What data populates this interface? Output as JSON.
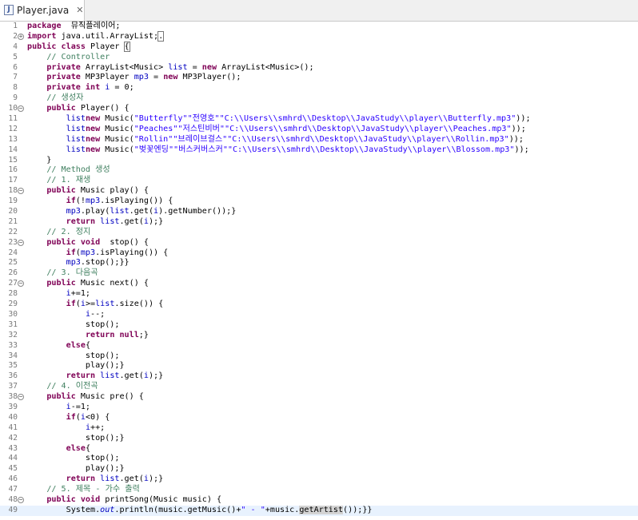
{
  "tab": {
    "title": "Player.java",
    "icon": "java-file-icon",
    "close": "✕"
  },
  "colors": {
    "keyword": "#7f0055",
    "string": "#2a00ff",
    "comment": "#3f7f5f",
    "field": "#0000c0"
  },
  "current_line": 49,
  "lines": [
    {
      "n": "1",
      "t": [
        [
          "kw",
          "package"
        ],
        [
          "",
          "  뮤직플레이어;"
        ]
      ]
    },
    {
      "n": "2",
      "fold": "+",
      "t": [
        [
          "kw",
          "import"
        ],
        [
          "",
          " java.util.ArrayList;"
        ],
        [
          "box",
          "."
        ]
      ]
    },
    {
      "n": "4",
      "t": [
        [
          "kw",
          "public class"
        ],
        [
          "",
          " Player "
        ],
        [
          "box",
          "{"
        ]
      ]
    },
    {
      "n": "5",
      "t": [
        [
          "",
          "    "
        ],
        [
          "cm",
          "// Controller"
        ]
      ]
    },
    {
      "n": "6",
      "t": [
        [
          "",
          "    "
        ],
        [
          "kw",
          "private"
        ],
        [
          "",
          " ArrayList<Music> "
        ],
        [
          "fld",
          "list"
        ],
        [
          "",
          " = "
        ],
        [
          "kw",
          "new"
        ],
        [
          "",
          " ArrayList<Music>();"
        ]
      ]
    },
    {
      "n": "7",
      "t": [
        [
          "",
          "    "
        ],
        [
          "kw",
          "private"
        ],
        [
          "",
          " MP3Player "
        ],
        [
          "fld",
          "mp3"
        ],
        [
          "",
          " = "
        ],
        [
          "kw",
          "new"
        ],
        [
          "",
          " MP3Player();"
        ]
      ]
    },
    {
      "n": "8",
      "t": [
        [
          "",
          "    "
        ],
        [
          "kw",
          "private int"
        ],
        [
          "",
          " "
        ],
        [
          "fld",
          "i"
        ],
        [
          "",
          " = 0;"
        ]
      ]
    },
    {
      "n": "9",
      "t": [
        [
          "",
          "    "
        ],
        [
          "cm",
          "// 생성자"
        ]
      ]
    },
    {
      "n": "10",
      "fold": "−",
      "t": [
        [
          "",
          "    "
        ],
        [
          "kw",
          "public"
        ],
        [
          "",
          " Player() {"
        ]
      ]
    },
    {
      "n": "11",
      "t": [
        [
          "",
          "        "
        ],
        [
          "fld",
          "list"
        ],
        [
          ".add("
        ],
        [
          "kw",
          "new"
        ],
        [
          "",
          " Music("
        ],
        [
          "str",
          "\"Butterfly\""
        ],
        [
          ", "
        ],
        [
          "str",
          "\"전영호\""
        ],
        [
          ", "
        ],
        [
          "str",
          "\"C:\\\\Users\\\\smhrd\\\\Desktop\\\\JavaStudy\\\\player\\\\Butterfly.mp3\""
        ],
        [
          "",
          "));"
        ]
      ]
    },
    {
      "n": "12",
      "t": [
        [
          "",
          "        "
        ],
        [
          "fld",
          "list"
        ],
        [
          ".add("
        ],
        [
          "kw",
          "new"
        ],
        [
          "",
          " Music("
        ],
        [
          "str",
          "\"Peaches\""
        ],
        [
          ", "
        ],
        [
          "str",
          "\"저스틴비버\""
        ],
        [
          ", "
        ],
        [
          "str",
          "\"C:\\\\Users\\\\smhrd\\\\Desktop\\\\JavaStudy\\\\player\\\\Peaches.mp3\""
        ],
        [
          "",
          "));"
        ]
      ]
    },
    {
      "n": "13",
      "t": [
        [
          "",
          "        "
        ],
        [
          "fld",
          "list"
        ],
        [
          ".add("
        ],
        [
          "kw",
          "new"
        ],
        [
          "",
          " Music("
        ],
        [
          "str",
          "\"Rollin\""
        ],
        [
          ", "
        ],
        [
          "str",
          "\"브레이브걸스\""
        ],
        [
          ", "
        ],
        [
          "str",
          "\"C:\\\\Users\\\\smhrd\\\\Desktop\\\\JavaStudy\\\\player\\\\Rollin.mp3\""
        ],
        [
          "",
          "));"
        ]
      ]
    },
    {
      "n": "14",
      "t": [
        [
          "",
          "        "
        ],
        [
          "fld",
          "list"
        ],
        [
          ".add("
        ],
        [
          "kw",
          "new"
        ],
        [
          "",
          " Music("
        ],
        [
          "str",
          "\"벚꽃엔딩\""
        ],
        [
          ", "
        ],
        [
          "str",
          "\"버스커버스커\""
        ],
        [
          ", "
        ],
        [
          "str",
          "\"C:\\\\Users\\\\smhrd\\\\Desktop\\\\JavaStudy\\\\player\\\\Blossom.mp3\""
        ],
        [
          "",
          "));"
        ]
      ]
    },
    {
      "n": "15",
      "t": [
        [
          "",
          "    }"
        ]
      ]
    },
    {
      "n": "16",
      "t": [
        [
          "",
          "    "
        ],
        [
          "cm",
          "// Method 생성"
        ]
      ]
    },
    {
      "n": "17",
      "t": [
        [
          "",
          "    "
        ],
        [
          "cm",
          "// 1. 재생"
        ]
      ]
    },
    {
      "n": "18",
      "fold": "−",
      "t": [
        [
          "",
          "    "
        ],
        [
          "kw",
          "public"
        ],
        [
          "",
          " Music play() {"
        ]
      ]
    },
    {
      "n": "19",
      "t": [
        [
          "",
          "        "
        ],
        [
          "kw",
          "if"
        ],
        [
          "",
          "(!"
        ],
        [
          "fld",
          "mp3"
        ],
        [
          "",
          ".isPlaying()) {"
        ]
      ]
    },
    {
      "n": "20",
      "t": [
        [
          "",
          "        "
        ],
        [
          "fld",
          "mp3"
        ],
        [
          "",
          ".play("
        ],
        [
          "fld",
          "list"
        ],
        [
          "",
          ".get("
        ],
        [
          "fld",
          "i"
        ],
        [
          "",
          ").getNumber());}"
        ]
      ]
    },
    {
      "n": "21",
      "t": [
        [
          "",
          "        "
        ],
        [
          "kw",
          "return"
        ],
        [
          "",
          " "
        ],
        [
          "fld",
          "list"
        ],
        [
          "",
          ".get("
        ],
        [
          "fld",
          "i"
        ],
        [
          "",
          ");}"
        ]
      ]
    },
    {
      "n": "22",
      "t": [
        [
          "",
          "    "
        ],
        [
          "cm",
          "// 2. 정지"
        ]
      ]
    },
    {
      "n": "23",
      "fold": "−",
      "t": [
        [
          "",
          "    "
        ],
        [
          "kw",
          "public void"
        ],
        [
          "",
          "  stop() {"
        ]
      ]
    },
    {
      "n": "24",
      "t": [
        [
          "",
          "        "
        ],
        [
          "kw",
          "if"
        ],
        [
          "",
          "("
        ],
        [
          "fld",
          "mp3"
        ],
        [
          "",
          ".isPlaying()) {"
        ]
      ]
    },
    {
      "n": "25",
      "t": [
        [
          "",
          "        "
        ],
        [
          "fld",
          "mp3"
        ],
        [
          "",
          ".stop();}}"
        ]
      ]
    },
    {
      "n": "26",
      "t": [
        [
          "",
          "    "
        ],
        [
          "cm",
          "// 3. 다음곡"
        ]
      ]
    },
    {
      "n": "27",
      "fold": "−",
      "t": [
        [
          "",
          "    "
        ],
        [
          "kw",
          "public"
        ],
        [
          "",
          " Music next() {"
        ]
      ]
    },
    {
      "n": "28",
      "t": [
        [
          "",
          "        "
        ],
        [
          "fld",
          "i"
        ],
        [
          "",
          "+=1;"
        ]
      ]
    },
    {
      "n": "29",
      "t": [
        [
          "",
          "        "
        ],
        [
          "kw",
          "if"
        ],
        [
          "",
          "("
        ],
        [
          "fld",
          "i"
        ],
        [
          "",
          ">="
        ],
        [
          "fld",
          "list"
        ],
        [
          "",
          ".size()) {"
        ]
      ]
    },
    {
      "n": "30",
      "t": [
        [
          "",
          "            "
        ],
        [
          "fld",
          "i"
        ],
        [
          "",
          "--;"
        ]
      ]
    },
    {
      "n": "31",
      "t": [
        [
          "",
          "            stop();"
        ]
      ]
    },
    {
      "n": "32",
      "t": [
        [
          "",
          "            "
        ],
        [
          "kw",
          "return null"
        ],
        [
          "",
          ";}"
        ]
      ]
    },
    {
      "n": "33",
      "t": [
        [
          "",
          "        "
        ],
        [
          "kw",
          "else"
        ],
        [
          "",
          "{"
        ]
      ]
    },
    {
      "n": "34",
      "t": [
        [
          "",
          "            stop();"
        ]
      ]
    },
    {
      "n": "35",
      "t": [
        [
          "",
          "            play();}"
        ]
      ]
    },
    {
      "n": "36",
      "t": [
        [
          "",
          "        "
        ],
        [
          "kw",
          "return"
        ],
        [
          "",
          " "
        ],
        [
          "fld",
          "list"
        ],
        [
          "",
          ".get("
        ],
        [
          "fld",
          "i"
        ],
        [
          "",
          ");}"
        ]
      ]
    },
    {
      "n": "37",
      "t": [
        [
          "",
          "    "
        ],
        [
          "cm",
          "// 4. 이전곡"
        ]
      ]
    },
    {
      "n": "38",
      "fold": "−",
      "t": [
        [
          "",
          "    "
        ],
        [
          "kw",
          "public"
        ],
        [
          "",
          " Music pre() {"
        ]
      ]
    },
    {
      "n": "39",
      "t": [
        [
          "",
          "        "
        ],
        [
          "fld",
          "i"
        ],
        [
          "",
          "-=1;"
        ]
      ]
    },
    {
      "n": "40",
      "t": [
        [
          "",
          "        "
        ],
        [
          "kw",
          "if"
        ],
        [
          "",
          "("
        ],
        [
          "fld",
          "i"
        ],
        [
          "",
          "<0) {"
        ]
      ]
    },
    {
      "n": "41",
      "t": [
        [
          "",
          "            "
        ],
        [
          "fld",
          "i"
        ],
        [
          "",
          "++;"
        ]
      ]
    },
    {
      "n": "42",
      "t": [
        [
          "",
          "            stop();}"
        ]
      ]
    },
    {
      "n": "43",
      "t": [
        [
          "",
          "        "
        ],
        [
          "kw",
          "else"
        ],
        [
          "",
          "{"
        ]
      ]
    },
    {
      "n": "44",
      "t": [
        [
          "",
          "            stop();"
        ]
      ]
    },
    {
      "n": "45",
      "t": [
        [
          "",
          "            play();}"
        ]
      ]
    },
    {
      "n": "46",
      "t": [
        [
          "",
          "        "
        ],
        [
          "kw",
          "return"
        ],
        [
          "",
          " "
        ],
        [
          "fld",
          "list"
        ],
        [
          "",
          ".get("
        ],
        [
          "fld",
          "i"
        ],
        [
          "",
          ");}"
        ]
      ]
    },
    {
      "n": "47",
      "t": [
        [
          "",
          "    "
        ],
        [
          "cm",
          "// 5. 제목 - 가수 출력"
        ]
      ]
    },
    {
      "n": "48",
      "fold": "−",
      "t": [
        [
          "",
          "    "
        ],
        [
          "kw",
          "public void"
        ],
        [
          "",
          " printSong(Music music) {"
        ]
      ]
    },
    {
      "n": "49",
      "t": [
        [
          "",
          "        System."
        ],
        [
          "stat",
          "out"
        ],
        [
          "",
          ".println(music.getMusic()+"
        ],
        [
          "str",
          "\" - \""
        ],
        [
          "",
          "+music."
        ],
        [
          "hl",
          "getArtist"
        ],
        [
          "",
          "());}}"
        ]
      ]
    }
  ]
}
